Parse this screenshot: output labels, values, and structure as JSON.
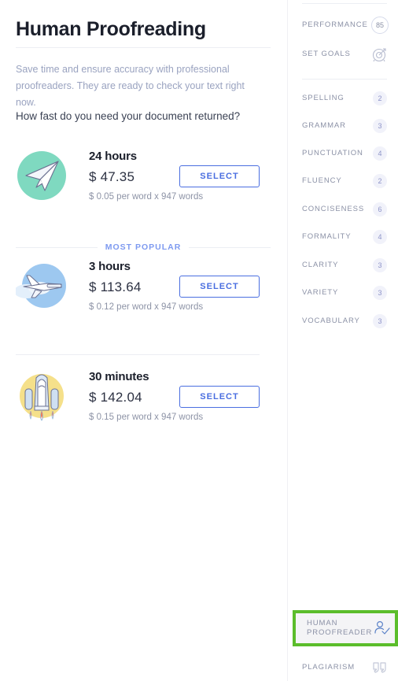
{
  "main": {
    "title": "Human Proofreading",
    "intro": "Save time and ensure accuracy with professional proofreaders. They are ready to check your text right now.",
    "question": "How fast do you need your document returned?",
    "popular_label": "MOST POPULAR",
    "options": [
      {
        "icon": "paper-plane-icon",
        "duration": "24 hours",
        "price": "$ 47.35",
        "rate": "$ 0.05 per word x 947 words",
        "select_label": "SELECT"
      },
      {
        "icon": "airplane-icon",
        "duration": "3 hours",
        "price": "$ 113.64",
        "rate": "$ 0.12 per word x 947 words",
        "select_label": "SELECT"
      },
      {
        "icon": "rocket-icon",
        "duration": "30 minutes",
        "price": "$ 142.04",
        "rate": "$ 0.15 per word x 947 words",
        "select_label": "SELECT"
      }
    ]
  },
  "sidebar": {
    "performance": {
      "label": "PERFORMANCE",
      "score": "85"
    },
    "set_goals": {
      "label": "SET GOALS",
      "icon": "target-icon"
    },
    "checks": [
      {
        "label": "SPELLING",
        "count": "2"
      },
      {
        "label": "GRAMMAR",
        "count": "3"
      },
      {
        "label": "PUNCTUATION",
        "count": "4"
      },
      {
        "label": "FLUENCY",
        "count": "2"
      },
      {
        "label": "CONCISENESS",
        "count": "6"
      },
      {
        "label": "FORMALITY",
        "count": "4"
      },
      {
        "label": "CLARITY",
        "count": "3"
      },
      {
        "label": "VARIETY",
        "count": "3"
      },
      {
        "label": "VOCABULARY",
        "count": "3"
      }
    ],
    "human_proofreader": {
      "line1": "HUMAN",
      "line2": "PROOFREADER",
      "icon": "person-check-icon",
      "highlight_color": "#5bbd2b"
    },
    "plagiarism": {
      "label": "PLAGIARISM",
      "icon": "quote-icon"
    }
  },
  "colors": {
    "accent_blue": "#4a6ee0",
    "popular_blue": "#7e9af0",
    "highlight_green": "#5bbd2b",
    "mint": "#7fd9c0",
    "sky": "#9dc8f0",
    "yellow": "#f5e08a"
  }
}
